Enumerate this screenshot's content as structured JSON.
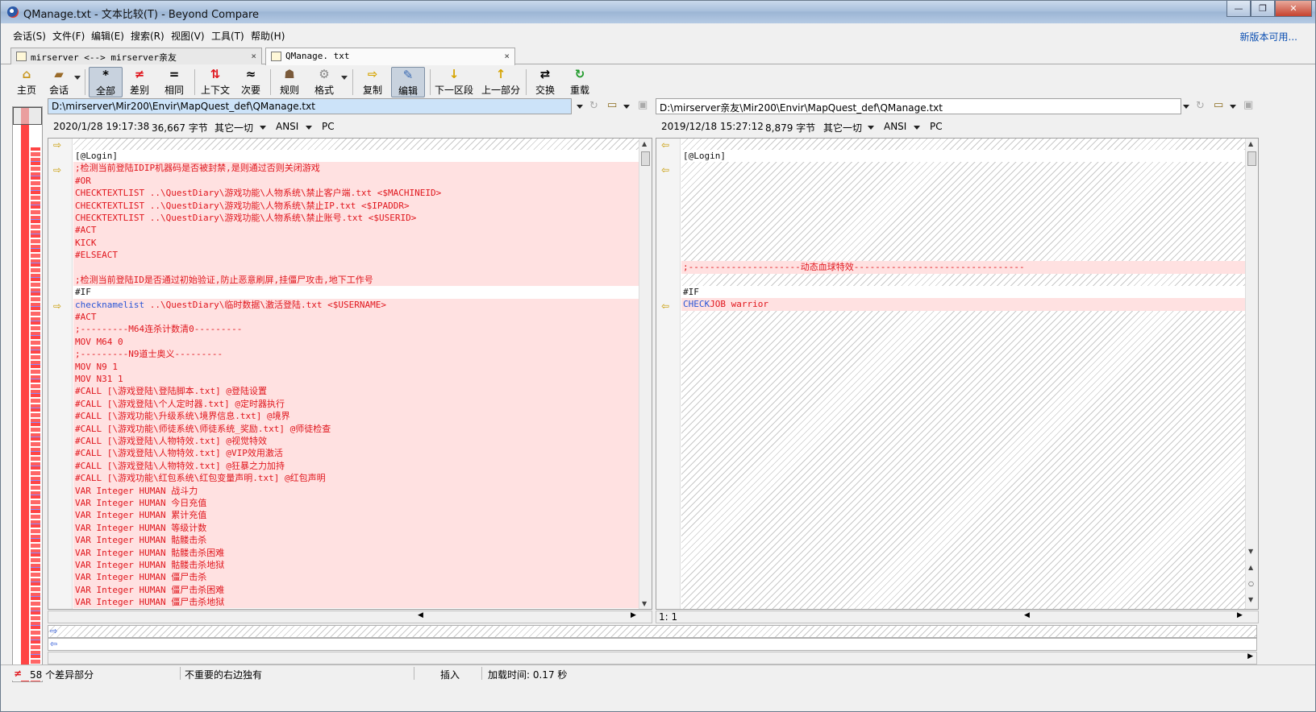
{
  "window": {
    "title": "QManage.txt - 文本比较(T) - Beyond Compare",
    "minimize": "—",
    "maximize": "❐",
    "close": "✕"
  },
  "menu": [
    "会话(S)",
    "文件(F)",
    "编辑(E)",
    "搜索(R)",
    "视图(V)",
    "工具(T)",
    "帮助(H)"
  ],
  "update_link": "新版本可用...",
  "tabs": [
    {
      "label": "mirserver <--> mirserver亲友",
      "close": "×"
    },
    {
      "label": "QManage. txt",
      "close": "×"
    }
  ],
  "toolbar": {
    "home": "主页",
    "session": "会话",
    "all": "全部",
    "diffs": "差别",
    "same": "相同",
    "context": "上下文",
    "minor": "次要",
    "rules": "规则",
    "format": "格式",
    "copy": "复制",
    "edit": "编辑",
    "next_section": "下一区段",
    "prev_part": "上一部分",
    "swap": "交换",
    "reload": "重载"
  },
  "left": {
    "path": "D:\\mirserver\\Mir200\\Envir\\MapQuest_def\\QManage.txt",
    "date": "2020/1/28 19:17:38",
    "size": "36,667 字节",
    "filter": "其它一切",
    "encoding": "ANSI",
    "line_endings": "PC",
    "lines": [
      {
        "t": "[@Login]",
        "c": "plain"
      },
      {
        "t": ";检测当前登陆IDIP机器码是否被封禁,是则通过否则关闭游戏",
        "c": "diff"
      },
      {
        "t": "#OR",
        "c": "diff"
      },
      {
        "t": "CHECKTEXTLIST ..\\QuestDiary\\游戏功能\\人物系统\\禁止客户端.txt <$MACHINEID>",
        "c": "diff"
      },
      {
        "t": "CHECKTEXTLIST ..\\QuestDiary\\游戏功能\\人物系统\\禁止IP.txt <$IPADDR>",
        "c": "diff"
      },
      {
        "t": "CHECKTEXTLIST ..\\QuestDiary\\游戏功能\\人物系统\\禁止账号.txt <$USERID>",
        "c": "diff"
      },
      {
        "t": "#ACT",
        "c": "diff"
      },
      {
        "t": "KICK",
        "c": "diff"
      },
      {
        "t": "#ELSEACT",
        "c": "diff"
      },
      {
        "t": "",
        "c": "diff"
      },
      {
        "t": ";检测当前登陆ID是否通过初始验证,防止恶意刷屏,挂僵尸攻击,地下工作号",
        "c": "diff"
      },
      {
        "t": "#IF",
        "c": "plain"
      },
      {
        "t": "checknamelist ..\\QuestDiary\\临时数据\\激活登陆.txt <$USERNAME>",
        "c": "diff"
      },
      {
        "t": "#ACT",
        "c": "diff"
      },
      {
        "t": ";---------M64连杀计数清0---------",
        "c": "diff"
      },
      {
        "t": "MOV M64 0",
        "c": "diff"
      },
      {
        "t": ";---------N9道士奥义---------",
        "c": "diff"
      },
      {
        "t": "MOV N9 1",
        "c": "diff"
      },
      {
        "t": "MOV N31 1",
        "c": "diff"
      },
      {
        "t": "#CALL [\\游戏登陆\\登陆脚本.txt] @登陆设置",
        "c": "diff"
      },
      {
        "t": "#CALL [\\游戏登陆\\个人定时器.txt] @定时器执行",
        "c": "diff"
      },
      {
        "t": "#CALL [\\游戏功能\\升级系统\\境界信息.txt] @境界",
        "c": "diff"
      },
      {
        "t": "#CALL [\\游戏功能\\师徒系统\\师徒系统_奖励.txt] @师徒检查",
        "c": "diff"
      },
      {
        "t": "#CALL [\\游戏登陆\\人物特效.txt] @视觉特效",
        "c": "diff"
      },
      {
        "t": "#CALL [\\游戏登陆\\人物特效.txt] @VIP效用激活",
        "c": "diff"
      },
      {
        "t": "#CALL [\\游戏登陆\\人物特效.txt] @狂暴之力加持",
        "c": "diff"
      },
      {
        "t": "#CALL [\\游戏功能\\红包系统\\红包变量声明.txt] @红包声明",
        "c": "diff"
      },
      {
        "t": "VAR Integer HUMAN 战斗力",
        "c": "diff"
      },
      {
        "t": "VAR Integer HUMAN 今日充值",
        "c": "diff"
      },
      {
        "t": "VAR Integer HUMAN 累计充值",
        "c": "diff"
      },
      {
        "t": "VAR Integer HUMAN 等级计数",
        "c": "diff"
      },
      {
        "t": "VAR Integer HUMAN 骷髅击杀",
        "c": "diff"
      },
      {
        "t": "VAR Integer HUMAN 骷髅击杀困难",
        "c": "diff"
      },
      {
        "t": "VAR Integer HUMAN 骷髅击杀地狱",
        "c": "diff"
      },
      {
        "t": "VAR Integer HUMAN 僵尸击杀",
        "c": "diff"
      },
      {
        "t": "VAR Integer HUMAN 僵尸击杀困难",
        "c": "diff"
      },
      {
        "t": "VAR Integer HUMAN 僵尸击杀地狱",
        "c": "diff"
      }
    ]
  },
  "right": {
    "path": "D:\\mirserver亲友\\Mir200\\Envir\\MapQuest_def\\QManage.txt",
    "date": "2019/12/18 15:27:12",
    "size": "8,879 字节",
    "filter": "其它一切",
    "encoding": "ANSI",
    "line_endings": "PC",
    "login": "[@Login]",
    "separator": ";---------------------动态血球特效--------------------------------",
    "if_line": "#IF",
    "checkjob_kw": "CHECK",
    "checkjob_rest": "JOB warrior",
    "cursor": "1: 1"
  },
  "status": {
    "diff_count": "58 个差异部分",
    "right_orphans": "不重要的右边独有",
    "mode": "插入",
    "load_time": "加载时间: 0.17 秒"
  }
}
